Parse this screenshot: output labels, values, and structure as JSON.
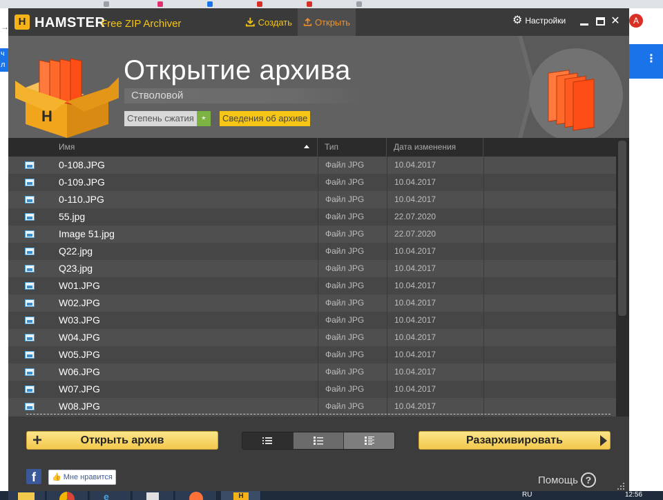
{
  "window": {
    "brand": "HAMSTER",
    "brand_sub": "Free ZIP Archiver",
    "logo_letter": "H",
    "create_label": "Создать",
    "open_label": "Открыть",
    "settings_label": "Настройки",
    "minimize_glyph": "▬",
    "maximize_glyph": "▢",
    "close_glyph": "✕"
  },
  "banner": {
    "title": "Открытие архива",
    "path": "Стволовой",
    "compression_label": "Степень сжатия",
    "compression_badge": "*",
    "info_label": "Сведения об архиве"
  },
  "table": {
    "columns": {
      "name": "Имя",
      "type": "Тип",
      "date": "Дата изменения"
    },
    "sort": "name-ascending",
    "rows": [
      {
        "name": "0-108.JPG",
        "type": "Файл JPG",
        "date": "10.04.2017"
      },
      {
        "name": "0-109.JPG",
        "type": "Файл JPG",
        "date": "10.04.2017"
      },
      {
        "name": "0-110.JPG",
        "type": "Файл JPG",
        "date": "10.04.2017"
      },
      {
        "name": "55.jpg",
        "type": "Файл JPG",
        "date": "22.07.2020"
      },
      {
        "name": "Image 51.jpg",
        "type": "Файл JPG",
        "date": "22.07.2020"
      },
      {
        "name": "Q22.jpg",
        "type": "Файл JPG",
        "date": "10.04.2017"
      },
      {
        "name": "Q23.jpg",
        "type": "Файл JPG",
        "date": "10.04.2017"
      },
      {
        "name": "W01.JPG",
        "type": "Файл JPG",
        "date": "10.04.2017"
      },
      {
        "name": "W02.JPG",
        "type": "Файл JPG",
        "date": "10.04.2017"
      },
      {
        "name": "W03.JPG",
        "type": "Файл JPG",
        "date": "10.04.2017"
      },
      {
        "name": "W04.JPG",
        "type": "Файл JPG",
        "date": "10.04.2017"
      },
      {
        "name": "W05.JPG",
        "type": "Файл JPG",
        "date": "10.04.2017"
      },
      {
        "name": "W06.JPG",
        "type": "Файл JPG",
        "date": "10.04.2017"
      },
      {
        "name": "W07.JPG",
        "type": "Файл JPG",
        "date": "10.04.2017"
      },
      {
        "name": "W08.JPG",
        "type": "Файл JPG",
        "date": "10.04.2017"
      }
    ]
  },
  "bottom": {
    "open_archive_label": "Открыть архив",
    "extract_label": "Разархивировать",
    "facebook_letter": "f",
    "like_label": "Мне нравится",
    "help_label": "Помощь",
    "help_glyph": "?"
  },
  "background": {
    "avatar_letter": "A",
    "left_blue_text": "ч\nл",
    "left_arrow": "→"
  },
  "taskbar": {
    "lang": "RU",
    "time": "12:56"
  },
  "colors": {
    "accent_yellow": "#f5c518",
    "accent_orange": "#f0922b",
    "panel_dark": "#3c3c3c",
    "banner": "#616161",
    "compression_green": "#7cb342"
  }
}
